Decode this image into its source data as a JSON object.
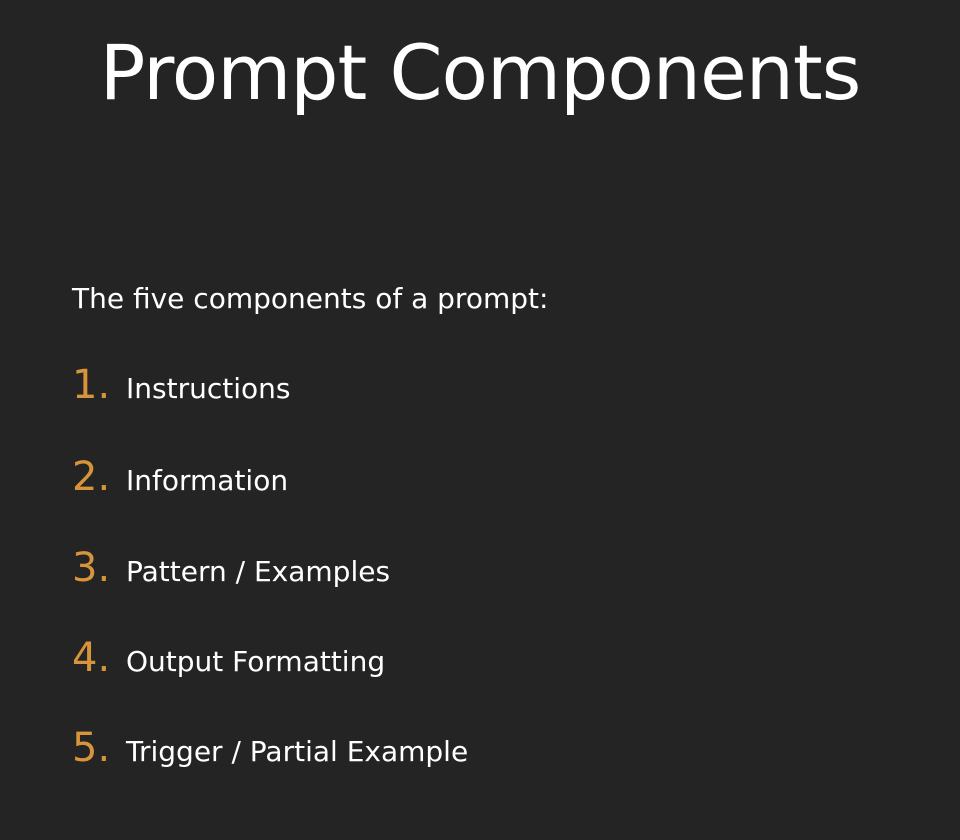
{
  "slide": {
    "title": "Prompt Components",
    "subtitle": "The five components of a prompt:",
    "accent_color": "#d8943a",
    "items": [
      {
        "number": "1.",
        "label": "Instructions"
      },
      {
        "number": "2.",
        "label": "Information"
      },
      {
        "number": "3.",
        "label": "Pattern / Examples"
      },
      {
        "number": "4.",
        "label": "Output Formatting"
      },
      {
        "number": "5.",
        "label": "Trigger / Partial Example"
      }
    ]
  }
}
